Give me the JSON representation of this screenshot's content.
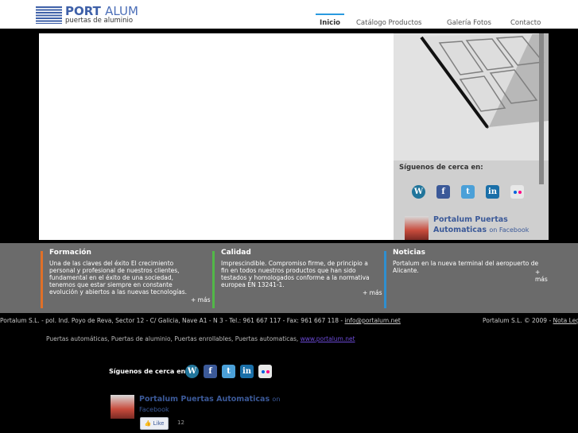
{
  "header": {
    "logo_bold": "PORT",
    "logo_light": "ALUM",
    "logo_tagline": "puertas de aluminio",
    "nav": [
      "Inicio",
      "Catálogo Productos",
      "Galería Fotos",
      "Contacto"
    ],
    "accent_color": "#2a9adf"
  },
  "sidebar": {
    "follow_label": "Síguenos de cerca en:",
    "social_icons": [
      "wordpress-icon",
      "facebook-icon",
      "twitter-icon",
      "linkedin-icon",
      "flickr-icon"
    ],
    "fb_title": "Portalum Puertas Automaticas",
    "fb_on": "on Facebook"
  },
  "columns": [
    {
      "title": "Formación",
      "text": "Una de las claves del éxito El crecimiento personal y profesional de nuestros clientes, fundamental en el éxito de una sociedad, tenemos que estar siempre en constante evolución y abiertos a las nuevas tecnologías.",
      "more": "+ más",
      "color": "#e07028"
    },
    {
      "title": "Calidad",
      "text": "Imprescindible. Compromiso firme, de principio a fin en todos nuestros productos que han sido testados y homologados conforme a la normativa europea EN 13241-1.",
      "more": "+ más",
      "color": "#52b848"
    },
    {
      "title": "Noticias",
      "text": "Portalum en la nueva terminal del aeropuerto de Alicante.",
      "more": "+ más",
      "color": "#2f8fd0"
    }
  ],
  "footer": {
    "address": "Portalum S.L. - pol. Ind. Poyo de Reva, Sector 12 - C/ Galicia, Nave A1 - N 3 - Tel.: 961 667 117 - Fax: 961 667 118 - ",
    "email": "info@portalum.net",
    "copyright": "Portalum S.L. © 2009 - ",
    "legal": "Nota Legal",
    "keywords": "Puertas automáticas, Puertas de aluminio, Puertas enrollables, Puertas automaticas, ",
    "site": "www.portalum.net",
    "follow_label": "Síguenos de cerca en:",
    "fb_title": "Portalum Puertas Automaticas",
    "fb_on": "on",
    "fb_on2": "Facebook",
    "like": "Like",
    "like_count": "12"
  }
}
